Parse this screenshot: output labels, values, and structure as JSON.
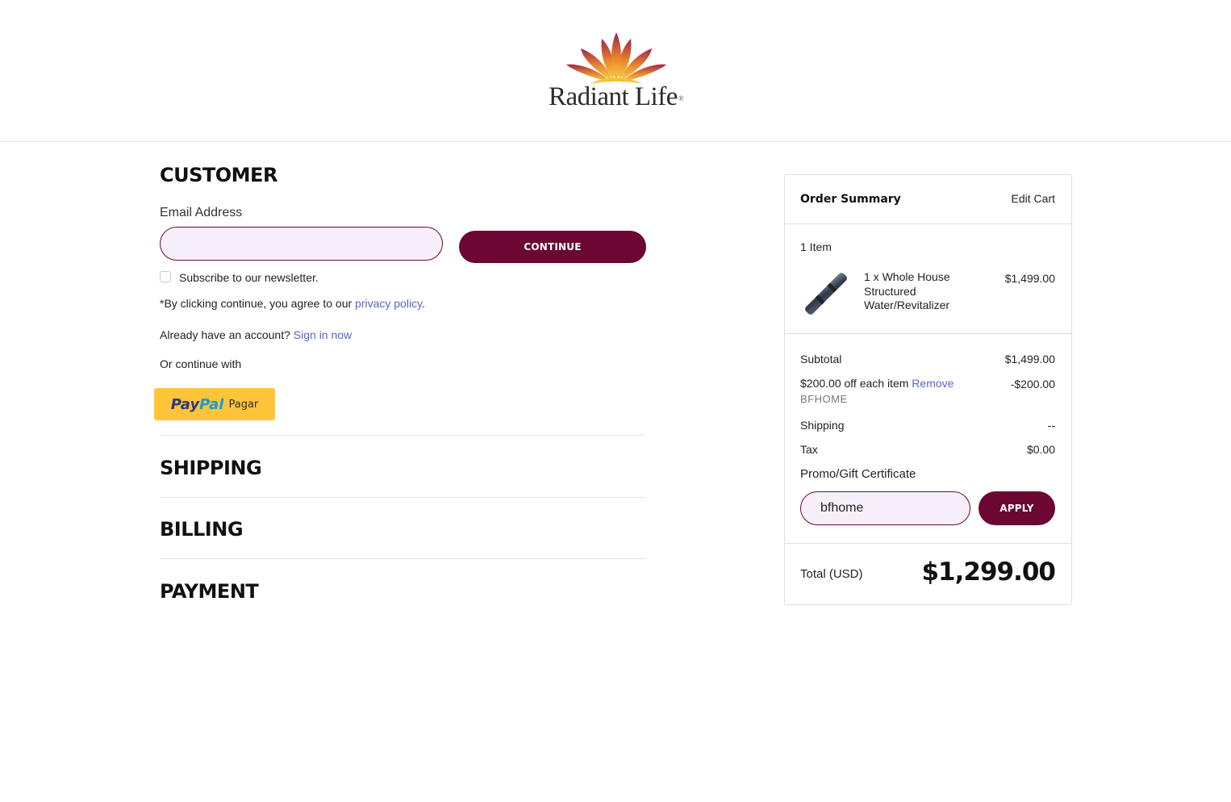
{
  "header": {
    "logo_text": "Radiant Life",
    "logo_mark": "®"
  },
  "customer": {
    "title": "CUSTOMER",
    "email_label": "Email Address",
    "email_value": "",
    "continue_label": "CONTINUE",
    "newsletter_label": "Subscribe to our newsletter.",
    "newsletter_checked": false,
    "agree_text": "*By clicking continue, you agree to our ",
    "privacy_link": "privacy policy",
    "agree_end": ".",
    "account_text": "Already have an account? ",
    "sign_in_link": "Sign in now",
    "or_continue": "Or continue with",
    "paypal": {
      "pay": "Pay",
      "pal": "Pal",
      "action": "Pagar",
      "color": "#ffc439"
    }
  },
  "sections": {
    "shipping": "SHIPPING",
    "billing": "BILLING",
    "payment": "PAYMENT"
  },
  "order_summary": {
    "title": "Order Summary",
    "edit_cart": "Edit Cart",
    "item_count": "1 Item",
    "item": {
      "line1": "1 x Whole House",
      "line2": "Structured",
      "line3": "Water/Revitalizer",
      "price": "$1,499.00",
      "icon": "product-image"
    },
    "subtotal_label": "Subtotal",
    "subtotal_value": "$1,499.00",
    "discount_label": "$200.00 off each item ",
    "discount_remove": "Remove",
    "discount_code": "BFHOME",
    "discount_value": "-$200.00",
    "shipping_label": "Shipping",
    "shipping_value": "--",
    "tax_label": "Tax",
    "tax_value": "$0.00",
    "promo_link": "Promo/Gift Certificate",
    "promo_value": "bfhome",
    "apply_label": "APPLY",
    "total_label": "Total (USD)",
    "total_value": "$1,299.00"
  },
  "colors": {
    "brand_maroon": "#6c0633",
    "link_blue": "#5b63c9",
    "input_bg": "#f7f0fa"
  }
}
